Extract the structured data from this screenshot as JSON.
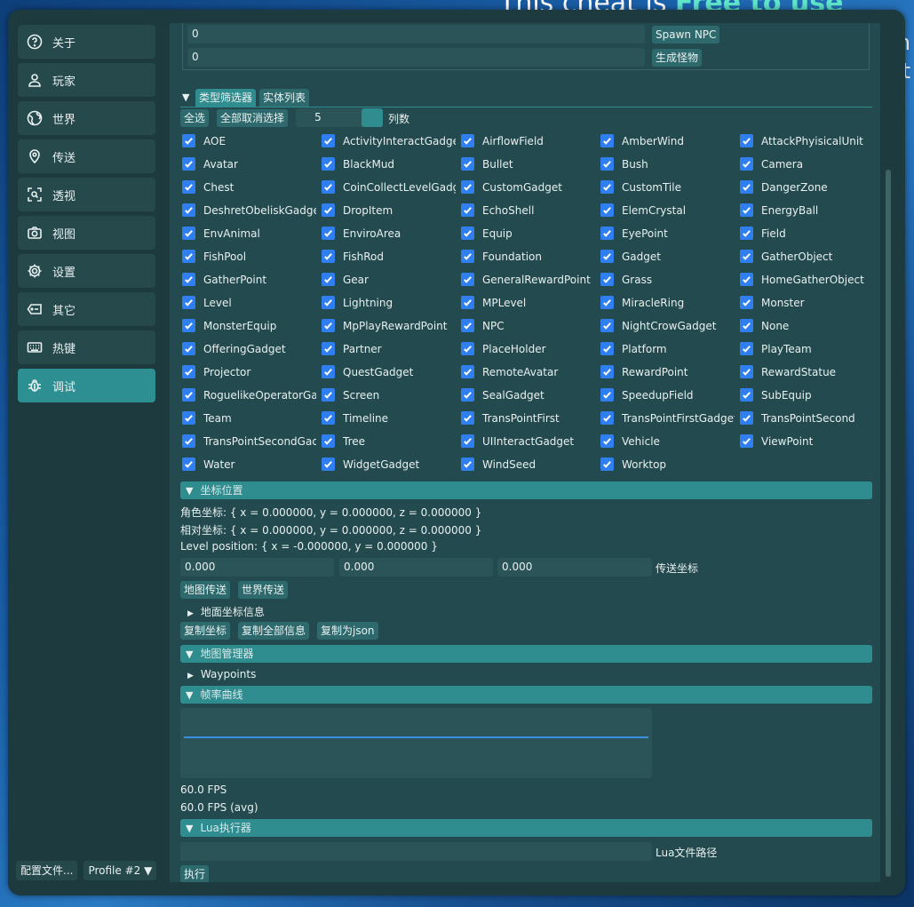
{
  "background": {
    "banner_prefix": "This cheat is ",
    "banner_highlight": "Free to use",
    "side_text_1": "n",
    "side_text_2": "t"
  },
  "sidebar": {
    "items": [
      {
        "label": "关于",
        "icon": "help-circle-icon"
      },
      {
        "label": "玩家",
        "icon": "user-icon"
      },
      {
        "label": "世界",
        "icon": "globe-icon"
      },
      {
        "label": "传送",
        "icon": "map-pin-icon"
      },
      {
        "label": "透视",
        "icon": "scan-icon"
      },
      {
        "label": "视图",
        "icon": "camera-icon"
      },
      {
        "label": "设置",
        "icon": "gear-icon"
      },
      {
        "label": "其它",
        "icon": "tag-icon"
      },
      {
        "label": "热键",
        "icon": "keyboard-icon"
      },
      {
        "label": "调试",
        "icon": "bug-icon"
      }
    ],
    "active_index": 9,
    "config_button": "配置文件...",
    "profile_select": "Profile #2"
  },
  "spawn": {
    "npc_value": "0",
    "npc_button": "Spawn NPC",
    "monster_value": "0",
    "monster_button": "生成怪物"
  },
  "tabs": [
    "类型筛选器",
    "实体列表"
  ],
  "filter": {
    "select_all": "全选",
    "deselect_all": "全部取消选择",
    "columns_value": "5",
    "columns_label": "列数",
    "items": [
      "AOE",
      "ActivityInteractGadget",
      "AirflowField",
      "AmberWind",
      "AttackPhyisicalUnit",
      "Avatar",
      "BlackMud",
      "Bullet",
      "Bush",
      "Camera",
      "Chest",
      "CoinCollectLevelGadget",
      "CustomGadget",
      "CustomTile",
      "DangerZone",
      "DeshretObeliskGadget",
      "DropItem",
      "EchoShell",
      "ElemCrystal",
      "EnergyBall",
      "EnvAnimal",
      "EnviroArea",
      "Equip",
      "EyePoint",
      "Field",
      "FishPool",
      "FishRod",
      "Foundation",
      "Gadget",
      "GatherObject",
      "GatherPoint",
      "Gear",
      "GeneralRewardPoint",
      "Grass",
      "HomeGatherObject",
      "Level",
      "Lightning",
      "MPLevel",
      "MiracleRing",
      "Monster",
      "MonsterEquip",
      "MpPlayRewardPoint",
      "NPC",
      "NightCrowGadget",
      "None",
      "OfferingGadget",
      "Partner",
      "PlaceHolder",
      "Platform",
      "PlayTeam",
      "Projector",
      "QuestGadget",
      "RemoteAvatar",
      "RewardPoint",
      "RewardStatue",
      "RoguelikeOperatorGadget",
      "Screen",
      "SealGadget",
      "SpeedupField",
      "SubEquip",
      "Team",
      "Timeline",
      "TransPointFirst",
      "TransPointFirstGadget",
      "TransPointSecond",
      "TransPointSecondGadget",
      "Tree",
      "UIInteractGadget",
      "Vehicle",
      "ViewPoint",
      "Water",
      "WidgetGadget",
      "WindSeed",
      "Worktop"
    ]
  },
  "coords": {
    "header": "坐标位置",
    "avatar": "角色坐标: { x = 0.000000, y = 0.000000, z = 0.000000 }",
    "relative": "相对坐标: { x = 0.000000, y = 0.000000, z = 0.000000 }",
    "level": "Level position: { x = -0.000000, y = 0.000000 }",
    "x": "0.000",
    "y": "0.000",
    "z": "0.000",
    "teleport_label": "传送坐标",
    "map_tp": "地图传送",
    "world_tp": "世界传送",
    "ground_info": "地面坐标信息",
    "copy_coords": "复制坐标",
    "copy_all": "复制全部信息",
    "copy_json": "复制为json"
  },
  "map_manager": {
    "header": "地图管理器",
    "waypoints": "Waypoints"
  },
  "fps": {
    "header": "帧率曲线",
    "current": "60.0 FPS",
    "avg": "60.0 FPS (avg)"
  },
  "lua": {
    "header": "Lua执行器",
    "path_label": "Lua文件路径",
    "path_value": "",
    "run": "执行"
  },
  "colors": {
    "accent": "#2f8c8f",
    "panel": "#1d3b3f",
    "checkbox": "#2f7ff0"
  }
}
